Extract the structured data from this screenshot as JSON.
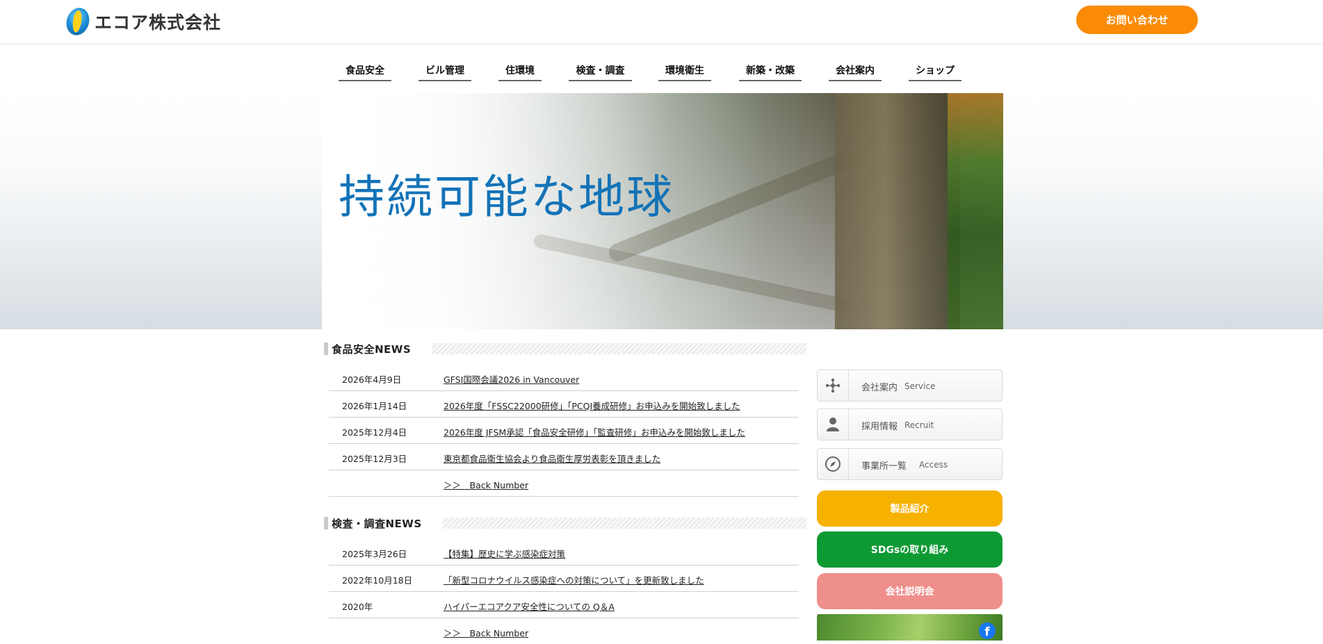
{
  "header": {
    "logo_text": "エコア株式会社",
    "contact_label": "お問い合わせ"
  },
  "nav": {
    "items": [
      "食品安全",
      "ビル管理",
      "住環境",
      "検査・調査",
      "環境衛生",
      "新築・改築",
      "会社案内",
      "ショップ"
    ]
  },
  "hero": {
    "title": "持続可能な地球"
  },
  "food_news": {
    "title": "食品安全NEWS",
    "rows": [
      {
        "date": "2026年4月9日",
        "text": "GFSI国際会議2026 in Vancouver"
      },
      {
        "date": "2026年1月14日",
        "text": "2026年度「FSSC22000研修」「PCQI養成研修」お申込みを開始致しました"
      },
      {
        "date": "2025年12月4日",
        "text": "2026年度 JFSM承認「食品安全研修」「監査研修」お申込みを開始致しました"
      },
      {
        "date": "2025年12月3日",
        "text": "東京都食品衛生協会より食品衛生厚労表彰を頂きました"
      }
    ],
    "back_number": "＞＞　Back Number"
  },
  "inspection_news": {
    "title": "検査・調査NEWS",
    "rows": [
      {
        "date": "2025年3月26日",
        "text": "【特集】歴史に学ぶ感染症対策"
      },
      {
        "date": "2022年10月18日",
        "text": "「新型コロナウイルス感染症への対策について」を更新致しました"
      },
      {
        "date": "2020年",
        "text": "ハイパーエコアクア安全性についての Q＆A"
      }
    ],
    "back_number": "＞＞　Back Number"
  },
  "sidebar": {
    "links": [
      {
        "jp": "会社案内",
        "en": "Service",
        "icon": "network-icon"
      },
      {
        "jp": "採用情報",
        "en": "Recruit",
        "icon": "person-icon"
      },
      {
        "jp": "事業所一覧",
        "en": "Access",
        "icon": "compass-icon"
      }
    ],
    "buttons": [
      {
        "label": "製品紹介",
        "color": "#f7b100"
      },
      {
        "label": "SDGsの取り組み",
        "color": "#0e9a33"
      },
      {
        "label": "会社説明会",
        "color": "#ef8f8c"
      }
    ]
  },
  "colors": {
    "accent_orange": "#fb8b06",
    "hero_title_blue": "#1373b8"
  }
}
